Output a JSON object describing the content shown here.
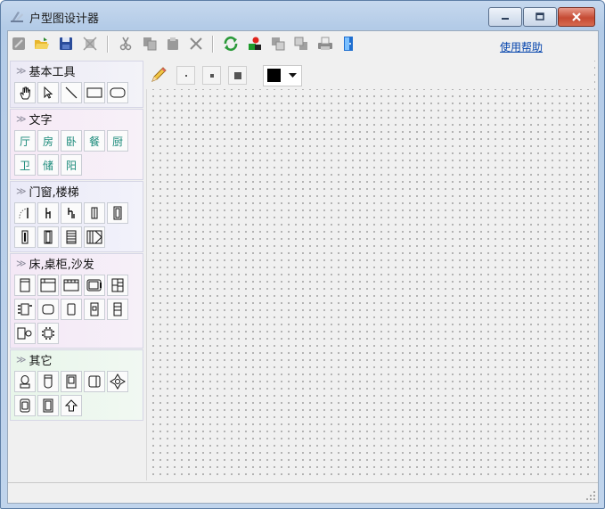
{
  "window": {
    "title": "户型图设计器"
  },
  "toolbar": {
    "buttons": [
      "new-icon",
      "open-icon",
      "save-icon",
      "clear-icon",
      "cut-icon",
      "copy-icon",
      "paste-icon",
      "delete-icon",
      "refresh-icon",
      "layers-icon",
      "bring-front-icon",
      "send-back-icon",
      "print-icon",
      "exit-icon"
    ],
    "help_link": "使用帮助"
  },
  "sidebar": {
    "categories": [
      {
        "name": "基本工具",
        "tools": [
          "hand-tool-icon",
          "arrow-select-icon",
          "line-tool-icon",
          "rectangle-tool-icon",
          "rounded-rect-tool-icon"
        ]
      },
      {
        "name": "文字",
        "tools": [
          "厅",
          "房",
          "卧",
          "餐",
          "厨",
          "卫",
          "储",
          "阳"
        ]
      },
      {
        "name": "门窗,楼梯",
        "tools": [
          "door-arc-icon",
          "door-right-icon",
          "door-left-icon",
          "window-icon",
          "window-wide-icon",
          "sliding-door-icon",
          "window-tall-icon",
          "stairs-icon",
          "stairs-turn-icon"
        ]
      },
      {
        "name": "床,桌柜,沙发",
        "tools": [
          "wardrobe-icon",
          "cabinet-top-icon",
          "cabinet-wide-icon",
          "sofa-icon",
          "bookshelf-icon",
          "dining-set-icon",
          "table-round-icon",
          "table-rect-icon",
          "nightstand-icon",
          "shelf-icon",
          "desk-chair-icon",
          "table-chairs-icon"
        ]
      },
      {
        "name": "其它",
        "tools": [
          "toilet-icon",
          "bathtub-icon",
          "fridge-icon",
          "sink-icon",
          "plant-icon",
          "washer-icon",
          "stove-icon",
          "arrow-up-icon"
        ]
      }
    ]
  },
  "canvas_tools": [
    "pencil-icon",
    "small-brush-icon",
    "medium-brush-icon",
    "large-brush-icon"
  ],
  "color": {
    "selected": "#000000"
  }
}
